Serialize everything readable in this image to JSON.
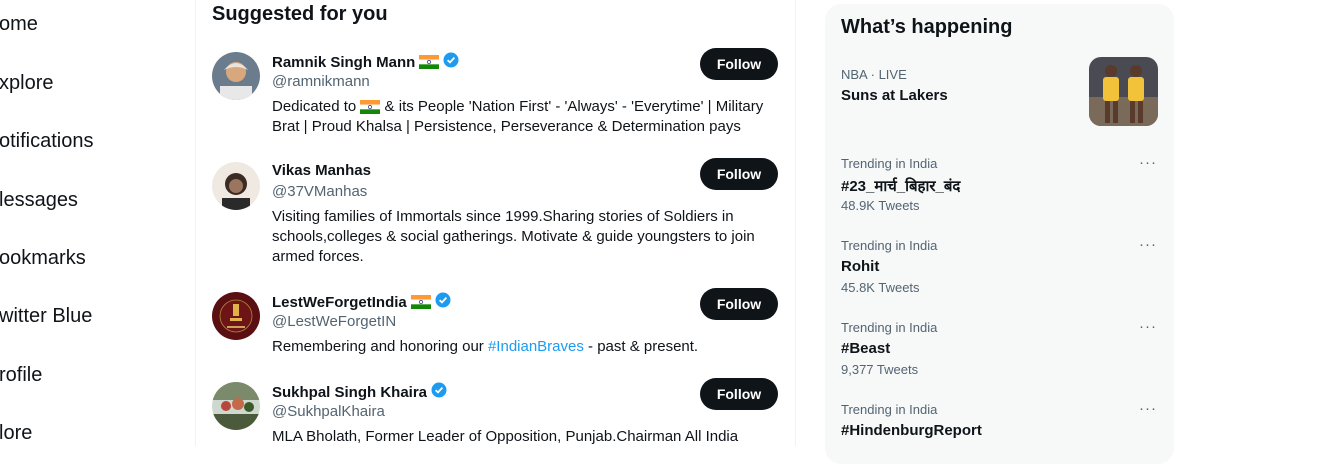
{
  "nav": {
    "items": [
      "ome",
      "xplore",
      "otifications",
      "lessages",
      "ookmarks",
      "witter Blue",
      "rofile",
      "lore"
    ]
  },
  "suggested": {
    "title": "Suggested for you",
    "follow_label": "Follow",
    "users": [
      {
        "name": "Ramnik Singh Mann",
        "handle": "@ramnikmann",
        "bio_pre": "Dedicated to ",
        "bio_post": " & its People 'Nation First' - 'Always' - 'Everytime' | Military Brat | Proud Khalsa | Persistence, Perseverance & Determination pays"
      },
      {
        "name": "Vikas Manhas",
        "handle": "@37VManhas",
        "bio": "Visiting families of Immortals since 1999.Sharing stories of Soldiers in schools,colleges & social gatherings. Motivate & guide youngsters to join armed forces."
      },
      {
        "name": "LestWeForgetIndia",
        "handle": "@LestWeForgetIN",
        "bio_pre": "Remembering and honoring our ",
        "bio_link": "#IndianBraves",
        "bio_post": " - past & present."
      },
      {
        "name": "Sukhpal Singh Khaira",
        "handle": "@SukhpalKhaira",
        "bio": "MLA Bholath, Former Leader of Opposition, Punjab.Chairman All India"
      }
    ]
  },
  "happening": {
    "title": "What’s happening",
    "trends": [
      {
        "meta": "NBA · LIVE",
        "topic": "Suns at Lakers"
      },
      {
        "meta": "Trending in India",
        "topic": "#23_मार्च_बिहार_बंद",
        "count": "48.9K Tweets"
      },
      {
        "meta": "Trending in India",
        "topic": "Rohit",
        "count": "45.8K Tweets"
      },
      {
        "meta": "Trending in India",
        "topic": "#Beast",
        "count": "9,377 Tweets"
      },
      {
        "meta": "Trending in India",
        "topic": "#HindenburgReport"
      }
    ],
    "more_label": "···"
  },
  "colors": {
    "accent": "#1d9bf0",
    "text": "#0f1419",
    "secondary": "#536471",
    "panel": "#f7f9f9"
  }
}
